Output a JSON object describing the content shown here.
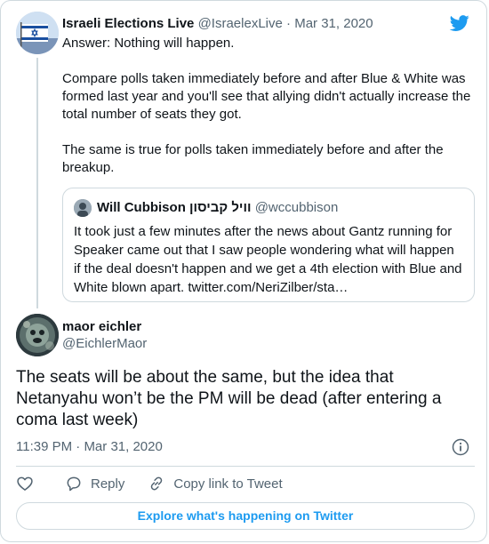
{
  "parent_tweet": {
    "author_name": "Israeli Elections Live",
    "handle": "@IsraelexLive",
    "separator": "·",
    "date": "Mar 31, 2020",
    "paragraphs": [
      "Answer: Nothing will happen.",
      "Compare polls taken immediately before and after Blue & White was formed last year and you'll see that allying didn't actually increase the total number of seats they got.",
      "The same is true for polls taken immediately before and after the breakup."
    ],
    "quoted_tweet": {
      "author_name": "Will Cubbison וויל קביסון",
      "handle": "@wccubbison",
      "text": "It took just a few minutes after the news about Gantz running for Speaker came out that I saw people wondering what will happen if the deal doesn't happen and we get a 4th election with Blue and White blown apart. twitter.com/NeriZilber/sta…"
    }
  },
  "main_tweet": {
    "author_name": "maor eichler",
    "handle": "@EichlerMaor",
    "text": "The seats will be about the same, but the idea that Netanyahu won’t be the PM will be dead (after entering a coma last week)",
    "time": "11:39 PM",
    "separator": "·",
    "date": "Mar 31, 2020"
  },
  "actions": {
    "like_icon": "heart-icon",
    "reply_label": "Reply",
    "reply_icon": "speech-bubble-icon",
    "copy_link_label": "Copy link to Tweet",
    "copy_link_icon": "link-icon"
  },
  "explore_button": "Explore what's happening on Twitter",
  "colors": {
    "brand_blue": "#1d9bf0",
    "text": "#0f1419",
    "muted": "#536471",
    "border": "#cfd9de"
  }
}
